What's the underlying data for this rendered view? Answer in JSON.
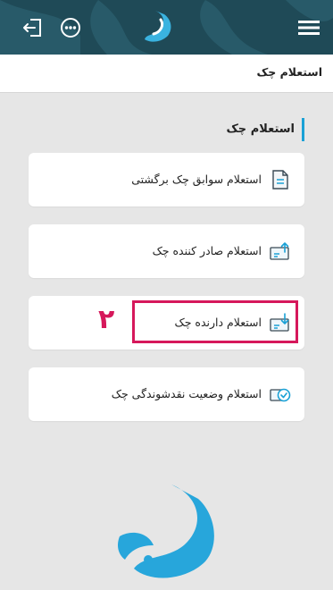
{
  "header": {
    "menu_icon": "hamburger-menu-icon",
    "more_icon": "more-options-icon",
    "exit_icon": "exit-icon",
    "logo": "bank-logo",
    "bg_color": "#1f4a57"
  },
  "titlebar": {
    "title": "استعلام چک"
  },
  "section": {
    "heading": "استعلام چک",
    "accent_color": "#1aa1d6"
  },
  "items": [
    {
      "label": "استعلام سوابق چک برگشتی",
      "icon": "document-icon"
    },
    {
      "label": "استعلام صادر کننده چک",
      "icon": "check-upload-icon"
    },
    {
      "label": "استعلام دارنده چک",
      "icon": "check-download-icon"
    },
    {
      "label": "استعلام وضعیت نقدشوندگی چک",
      "icon": "check-status-icon"
    }
  ],
  "annotation": {
    "step_number": "۲",
    "color": "#d6185b"
  }
}
